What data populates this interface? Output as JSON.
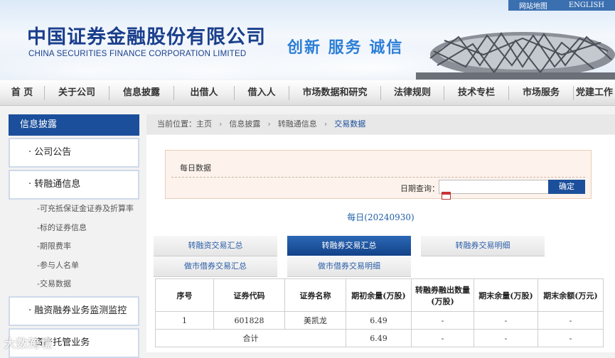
{
  "header": {
    "top_links": [
      "网站地图",
      "ENGLISH"
    ],
    "logo_cn": "中国证券金融股份有限公司",
    "logo_en": "CHINA SECURITIES FINANCE CORPORATION LIMITED",
    "slogan": "创新 服务 诚信"
  },
  "nav": [
    "首 页",
    "关于公司",
    "信息披露",
    "出借人",
    "借入人",
    "市场数据和研究",
    "法律规则",
    "技术专栏",
    "市场服务",
    "党建工作"
  ],
  "sidebar": {
    "title": "信息披露",
    "items": [
      {
        "label": "· 公司公告"
      },
      {
        "label": "· 转融通信息"
      },
      {
        "label": "-可充抵保证金证券及折算率"
      },
      {
        "label": "-标的证券信息"
      },
      {
        "label": "-期限费率"
      },
      {
        "label": "-参与人名单"
      },
      {
        "label": "-交易数据"
      },
      {
        "label": "· 融资融券业务监测监控"
      },
      {
        "label": "· 资产托管业务"
      }
    ]
  },
  "breadcrumb": {
    "prefix": "当前位置：",
    "items": [
      "主页",
      "信息披露",
      "转融通信息",
      "交易数据"
    ]
  },
  "daily": {
    "title": "每日数据",
    "date_label": "日期查询：",
    "date_value": "",
    "query_button": "确定"
  },
  "subhead": "每日(20240930)",
  "tabs": [
    {
      "label": "转融资交易汇总",
      "active": false
    },
    {
      "label": "转融券交易汇总",
      "active": true
    },
    {
      "label": "转融券交易明细",
      "active": false
    },
    {
      "label": "做市借券交易汇总",
      "active": false
    },
    {
      "label": "做市借券交易明细",
      "active": false
    }
  ],
  "table": {
    "headers": [
      "序号",
      "证券代码",
      "证券名称",
      "期初余量(万股)",
      "转融券融出数量(万股)",
      "期末余量(万股)",
      "期末余额(万元)"
    ],
    "rows": [
      [
        "1",
        "601828",
        "美凯龙",
        "6.49",
        "-",
        "-",
        "-"
      ]
    ],
    "total": [
      "合计",
      "6.49",
      "-",
      "-",
      "-"
    ]
  },
  "watermark": "大数跨境"
}
